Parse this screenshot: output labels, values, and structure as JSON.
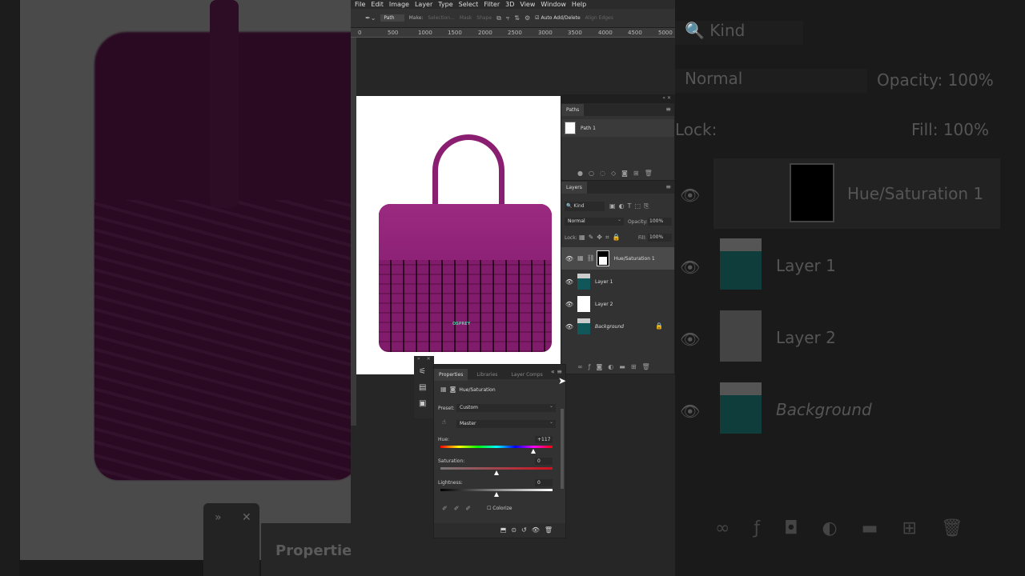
{
  "menu": [
    "File",
    "Edit",
    "Image",
    "Layer",
    "Type",
    "Select",
    "Filter",
    "3D",
    "View",
    "Window",
    "Help"
  ],
  "options_bar": {
    "mode": "Path",
    "make_label": "Make:",
    "selection_btn": "Selection...",
    "mask_btn": "Mask",
    "shape_btn": "Shape",
    "auto_add_delete": "Auto Add/Delete",
    "auto_add_delete_checked": true,
    "align_edges": "Align Edges"
  },
  "ruler_ticks": [
    "0",
    "500",
    "1000",
    "1500",
    "2000",
    "2500",
    "3000",
    "3500",
    "4000",
    "4500",
    "5000"
  ],
  "document": {
    "brand_text": "OSPREY",
    "bag_color": "#8a1f72"
  },
  "paths_panel": {
    "tab": "Paths",
    "items": [
      {
        "name": "Path 1"
      }
    ]
  },
  "layers_panel": {
    "tab": "Layers",
    "filter": "Kind",
    "blend_mode": "Normal",
    "opacity_label": "Opacity:",
    "opacity": "100%",
    "lock_label": "Lock:",
    "fill_label": "Fill:",
    "fill": "100%",
    "layers": [
      {
        "name": "Hue/Saturation 1",
        "type": "adjustment",
        "selected": true
      },
      {
        "name": "Layer 1",
        "type": "pixel"
      },
      {
        "name": "Layer 2",
        "type": "white"
      },
      {
        "name": "Background",
        "type": "background",
        "locked": true
      }
    ]
  },
  "properties_panel": {
    "tabs": [
      "Properties",
      "Libraries",
      "Layer Comps"
    ],
    "title": "Hue/Saturation",
    "preset_label": "Preset:",
    "preset": "Custom",
    "channel": "Master",
    "hue_label": "Hue:",
    "hue": "+117",
    "hue_fraction": 0.825,
    "saturation_label": "Saturation:",
    "saturation": "0",
    "saturation_fraction": 0.5,
    "lightness_label": "Lightness:",
    "lightness": "0",
    "lightness_fraction": 0.5,
    "colorize_label": "Colorize",
    "colorize": false
  },
  "background_right": {
    "filter": "Kind",
    "blend_mode": "Normal",
    "opacity_label": "Opacity:",
    "opacity": "100%",
    "lock_label": "Lock:",
    "fill_label": "Fill:",
    "fill": "100%",
    "layers": [
      "Hue/Saturation 1",
      "Layer 1",
      "Layer 2",
      "Background"
    ]
  },
  "background_left": {
    "properties_label": "Properties"
  }
}
